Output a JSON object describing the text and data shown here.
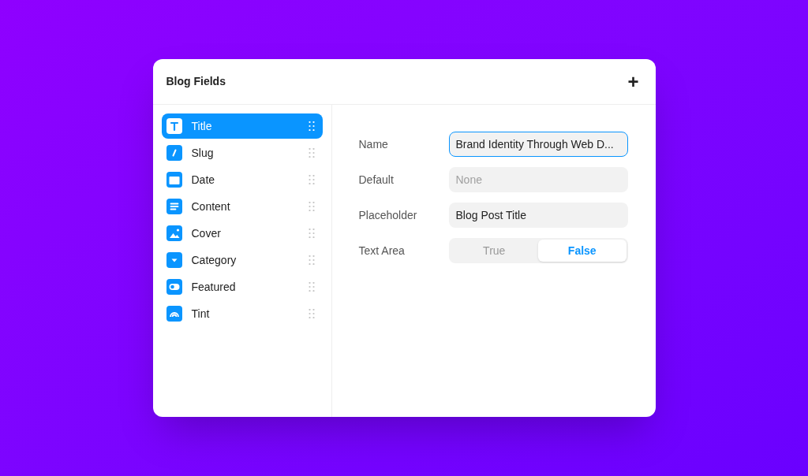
{
  "panel": {
    "title": "Blog Fields",
    "add_button": "+"
  },
  "sidebar": {
    "items": [
      {
        "label": "Title",
        "kind": "text",
        "selected": true
      },
      {
        "label": "Slug",
        "kind": "slug",
        "selected": false
      },
      {
        "label": "Date",
        "kind": "date",
        "selected": false
      },
      {
        "label": "Content",
        "kind": "content",
        "selected": false
      },
      {
        "label": "Cover",
        "kind": "image",
        "selected": false
      },
      {
        "label": "Category",
        "kind": "dropdown",
        "selected": false
      },
      {
        "label": "Featured",
        "kind": "toggle",
        "selected": false
      },
      {
        "label": "Tint",
        "kind": "color",
        "selected": false
      }
    ]
  },
  "properties": [
    {
      "label": "Name",
      "kind": "text",
      "value": "Brand Identity Through Web D...",
      "focused": true
    },
    {
      "label": "Default",
      "kind": "text",
      "placeholder": "None",
      "focused": false
    },
    {
      "label": "Placeholder",
      "kind": "text",
      "value": "Blog Post Title",
      "focused": false
    },
    {
      "label": "Text Area",
      "kind": "segmented",
      "options": [
        {
          "label": "True",
          "selected": false
        },
        {
          "label": "False",
          "selected": true
        }
      ]
    }
  ]
}
